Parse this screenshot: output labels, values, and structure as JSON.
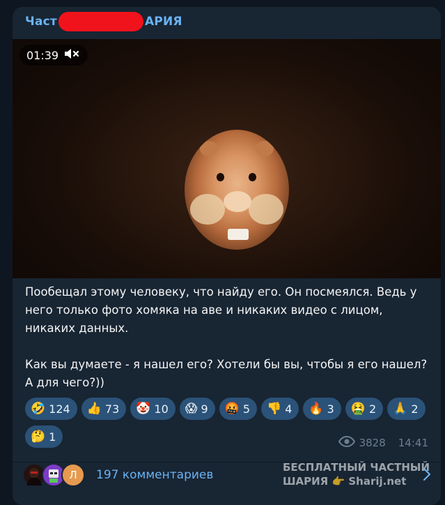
{
  "post": {
    "channel_prefix": "Част",
    "channel_suffix": "АРИЯ",
    "video": {
      "time": "01:39",
      "muted": true
    },
    "text_paragraphs": [
      "Пообещал этому человеку, что найду его. Он посмеялся. Ведь у него только фото хомяка на аве и никаких видео с лицом, никаких данных.",
      "Как вы думаете - я нашел его? Хотели бы вы, чтобы я его нашел? А для чего?))"
    ],
    "reactions": [
      {
        "emoji": "🤣",
        "count": "124"
      },
      {
        "emoji": "👍",
        "count": "73"
      },
      {
        "emoji": "🤡",
        "count": "10"
      },
      {
        "emoji": "😱",
        "count": "9"
      },
      {
        "emoji": "🤬",
        "count": "5"
      },
      {
        "emoji": "👎",
        "count": "4"
      },
      {
        "emoji": "🔥",
        "count": "3"
      },
      {
        "emoji": "🤮",
        "count": "2"
      },
      {
        "emoji": "🙏",
        "count": "2"
      },
      {
        "emoji": "🤔",
        "count": "1"
      }
    ],
    "views": "3828",
    "time": "14:41",
    "comments_label": "197 комментариев",
    "avatar_letter": "Л",
    "watermark_line1": "БЕСПЛАТНЫЙ ЧАСТНЫЙ",
    "watermark_line2": "ШАРИЯ 👉 Sharij.net"
  },
  "colors": {
    "background": "#0e1621",
    "card": "#182533",
    "accent": "#6ab2f2",
    "reaction_chip": "#2b5278",
    "meta": "#6d7f8f",
    "redaction": "#f0131b"
  }
}
